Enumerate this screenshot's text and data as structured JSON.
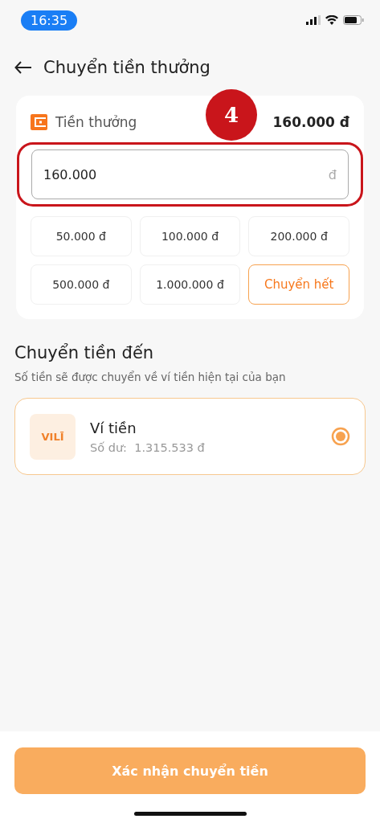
{
  "status_bar": {
    "time": "16:35"
  },
  "header": {
    "title": "Chuyển tiền thưởng"
  },
  "bonus": {
    "label": "Tiền thưởng",
    "balance": "160.000 đ",
    "amount_field": {
      "value": "160.000",
      "currency": "đ"
    },
    "chips": [
      {
        "label": "50.000 đ",
        "kind": "amount"
      },
      {
        "label": "100.000 đ",
        "kind": "amount"
      },
      {
        "label": "200.000 đ",
        "kind": "amount"
      },
      {
        "label": "500.000 đ",
        "kind": "amount"
      },
      {
        "label": "1.000.000 đ",
        "kind": "amount"
      },
      {
        "label": "Chuyển hết",
        "kind": "all"
      }
    ]
  },
  "annotation": {
    "step": "4"
  },
  "destination": {
    "title": "Chuyển tiền đến",
    "subtitle": "Số tiền sẽ được chuyển về ví tiền hiện tại của bạn",
    "options": [
      {
        "logo": "VILĪ",
        "name": "Ví tiền",
        "balance_label": "Số dư:",
        "balance": "1.315.533 đ",
        "selected": true
      }
    ]
  },
  "confirm_button": {
    "label": "Xác nhận chuyển tiền"
  }
}
